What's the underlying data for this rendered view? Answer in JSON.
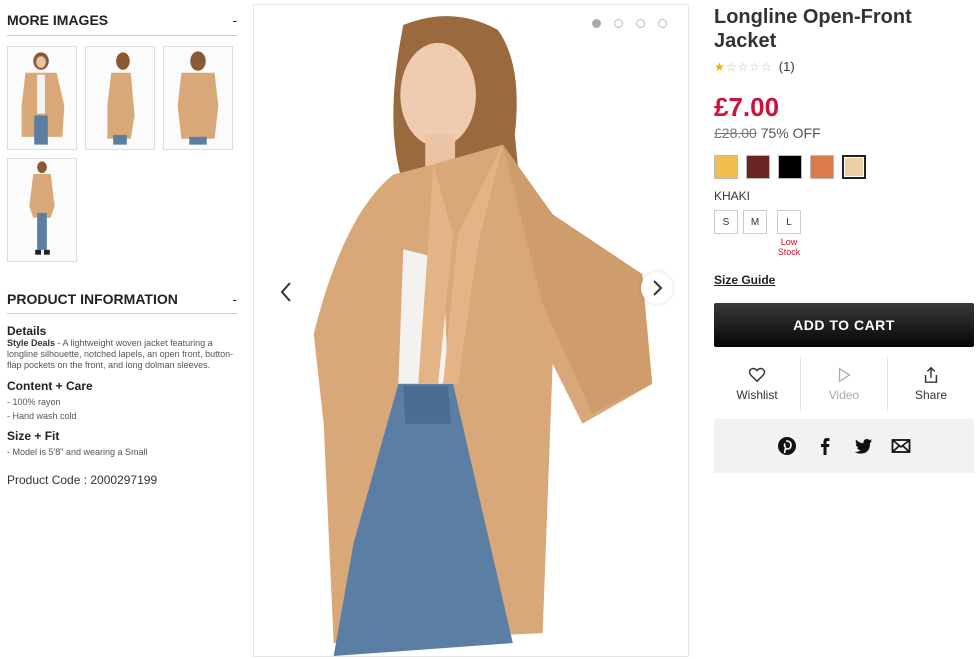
{
  "images_section": {
    "title": "MORE IMAGES",
    "toggle": "-",
    "thumbnails": [
      {
        "icon": "model-front-view"
      },
      {
        "icon": "model-side-view"
      },
      {
        "icon": "model-back-view"
      },
      {
        "icon": "model-full-view"
      }
    ]
  },
  "info_section": {
    "title": "PRODUCT INFORMATION",
    "toggle": "-",
    "details_title": "Details",
    "details_lead": "Style Deals",
    "details_text": " - A lightweight woven jacket featuring a longline silhouette, notched lapels, an open front, button-flap pockets on the front, and long dolman sleeves.",
    "content_title": "Content + Care",
    "content_items": [
      "- 100% rayon",
      "- Hand wash cold"
    ],
    "fit_title": "Size + Fit",
    "fit_items": [
      "- Model is 5'8\" and wearing a Small"
    ],
    "product_code": "Product Code : 2000297199"
  },
  "gallery": {
    "dots": 4,
    "active_dot": 0
  },
  "product": {
    "title": "Longline Open-Front Jacket",
    "rating_filled": 1,
    "rating_total": 5,
    "review_count": "(1)",
    "price": "£7.00",
    "was_price": "£28.00",
    "discount": "75% OFF",
    "colors": [
      "#f0bf50",
      "#6b2322",
      "#000000",
      "#dd7a4c",
      "#ecd1a6"
    ],
    "selected_color_index": 4,
    "color_name": "KHAKI",
    "sizes": [
      {
        "label": "S",
        "note": ""
      },
      {
        "label": "M",
        "note": ""
      },
      {
        "label": "L",
        "note": "Low Stock"
      }
    ],
    "size_guide": "Size Guide",
    "add_to_cart": "ADD TO CART",
    "actions": [
      {
        "label": "Wishlist",
        "icon": "heart-icon"
      },
      {
        "label": "Video",
        "icon": "play-icon"
      },
      {
        "label": "Share",
        "icon": "share-icon"
      }
    ],
    "social_icons": [
      "pinterest-icon",
      "facebook-icon",
      "twitter-icon",
      "email-icon"
    ]
  },
  "colors": {
    "price_red": "#d0103a",
    "low_stock_red": "#c41230",
    "jacket_tan": "#d9a878"
  }
}
